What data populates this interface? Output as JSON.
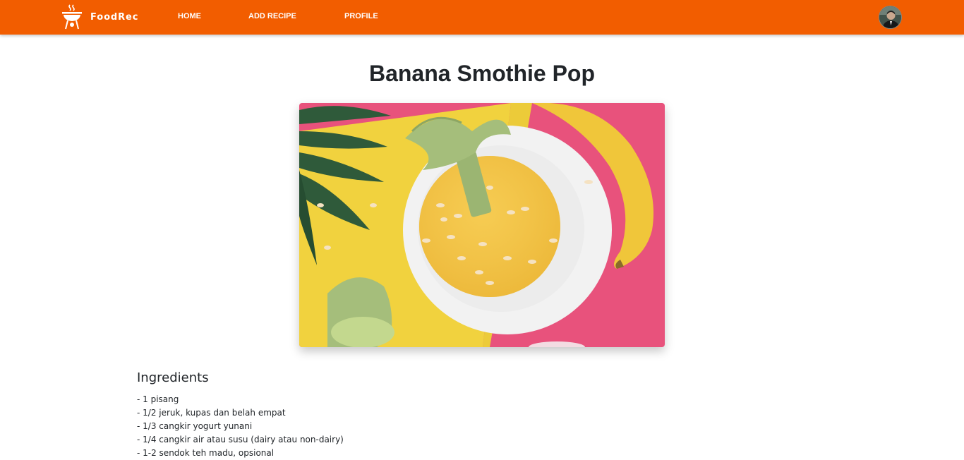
{
  "nav": {
    "brand": "FoodRec",
    "links": [
      "HOME",
      "ADD RECIPE",
      "PROFILE"
    ],
    "brand_icon": "grill-icon",
    "avatar_icon": "user-avatar"
  },
  "colors": {
    "nav_background": "#f25d00",
    "nav_text": "#ffffff",
    "title_text": "#212529"
  },
  "recipe": {
    "title": "Banana Smothie Pop",
    "image_content": "banana-smoothie-bowl-photo",
    "ingredients_heading": "Ingredients",
    "ingredients": [
      "- 1 pisang",
      "- 1/2 jeruk, kupas dan belah empat",
      "- 1/3 cangkir yogurt yunani",
      "- 1/4 cangkir air atau susu (dairy atau non-dairy)",
      "- 1-2 sendok teh madu, opsional"
    ]
  }
}
